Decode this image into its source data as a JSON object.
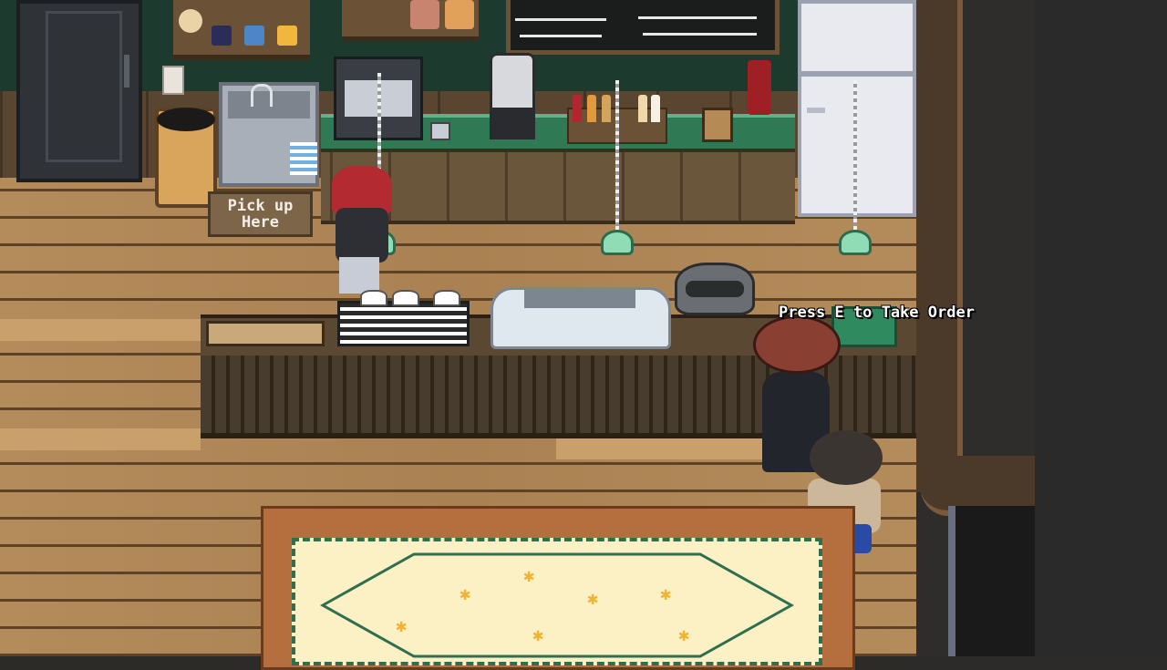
{
  "sign": {
    "line1": "Pick up",
    "line2": "Here"
  },
  "prompt": {
    "text": "Press E to Take Order",
    "key": "E"
  },
  "colors": {
    "floor": "#b28a5a",
    "wall": "#1d3a2f",
    "counter_green": "#2f7a55",
    "lamp": "#8fdcb5",
    "prompt_text": "#ffffff"
  },
  "icons": [
    "pendant-lamp-icon",
    "mug-icon",
    "cup-icon",
    "bottle-icon"
  ]
}
